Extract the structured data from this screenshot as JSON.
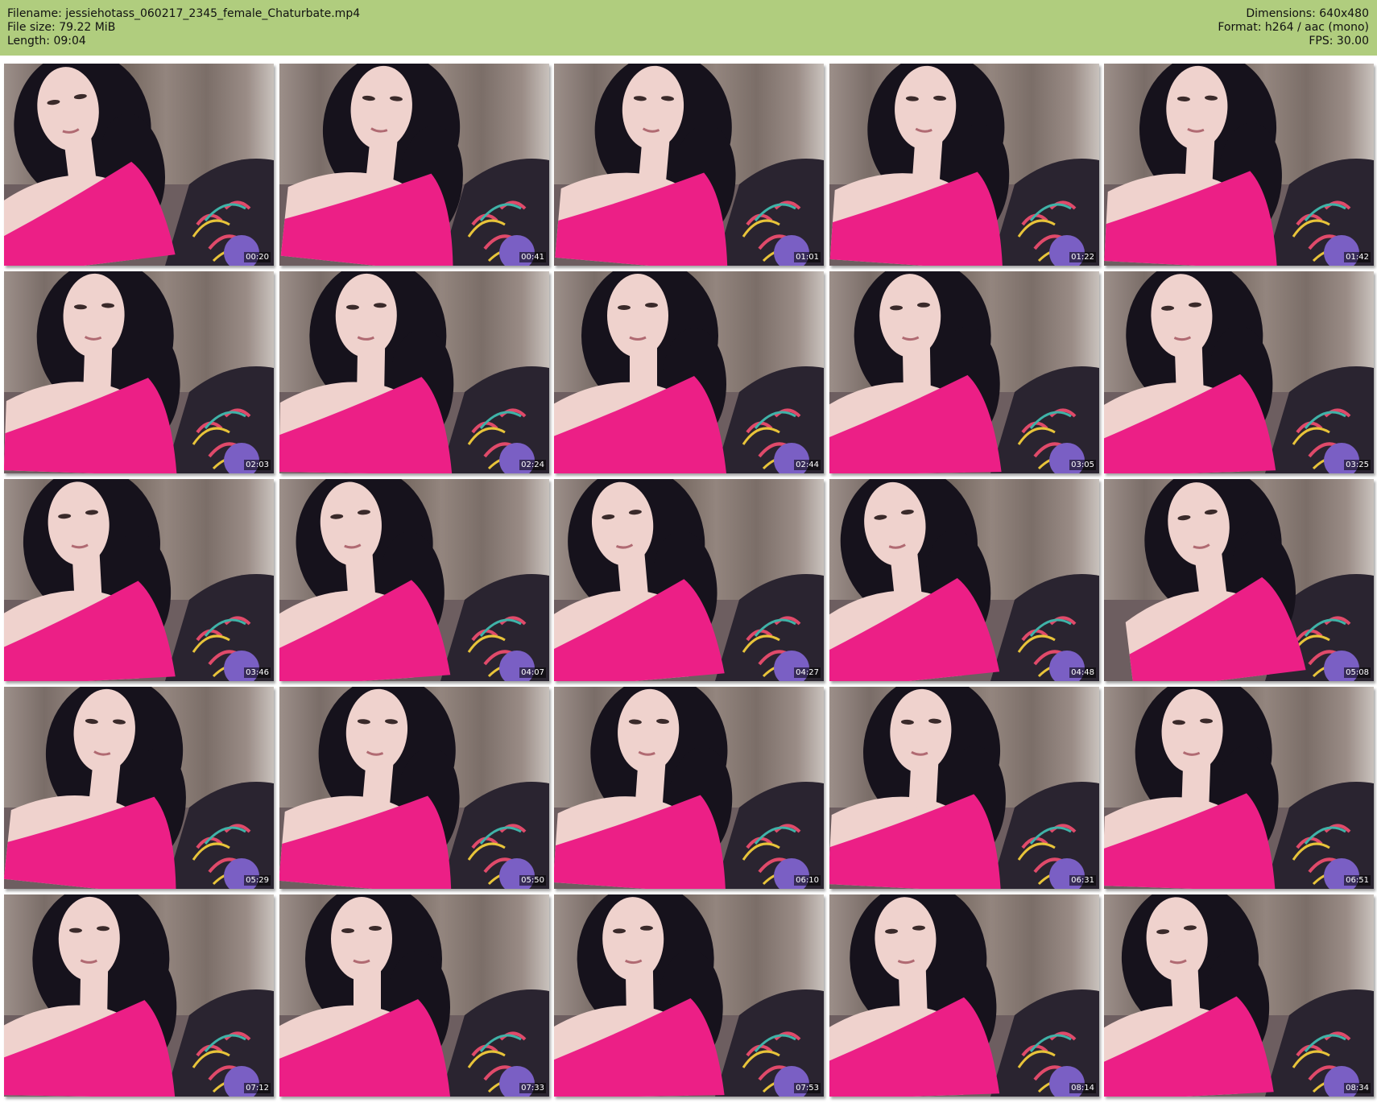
{
  "header": {
    "filename_line": "Filename: jessiehotass_060217_2345_female_Chaturbate.mp4",
    "filesize_line": "File size: 79.22 MiB",
    "length_line": "Length: 09:04",
    "dimensions_line": "Dimensions: 640x480",
    "format_line": "Format: h264 / aac (mono)",
    "fps_line": "FPS: 30.00"
  },
  "colors": {
    "header_bg": "#b0cd7e",
    "top": "#ec1f86",
    "hair": "#16121c",
    "skin": "#efd2cd",
    "curtain": "#8c7d77",
    "couch": "#6d5e60",
    "pillow": "#2a2430"
  },
  "thumbnails": [
    {
      "time": "00:20"
    },
    {
      "time": "00:41"
    },
    {
      "time": "01:01"
    },
    {
      "time": "01:22"
    },
    {
      "time": "01:42"
    },
    {
      "time": "02:03"
    },
    {
      "time": "02:24"
    },
    {
      "time": "02:44"
    },
    {
      "time": "03:05"
    },
    {
      "time": "03:25"
    },
    {
      "time": "03:46"
    },
    {
      "time": "04:07"
    },
    {
      "time": "04:27"
    },
    {
      "time": "04:48"
    },
    {
      "time": "05:08"
    },
    {
      "time": "05:29"
    },
    {
      "time": "05:50"
    },
    {
      "time": "06:10"
    },
    {
      "time": "06:31"
    },
    {
      "time": "06:51"
    },
    {
      "time": "07:12"
    },
    {
      "time": "07:33"
    },
    {
      "time": "07:53"
    },
    {
      "time": "08:14"
    },
    {
      "time": "08:34"
    }
  ]
}
